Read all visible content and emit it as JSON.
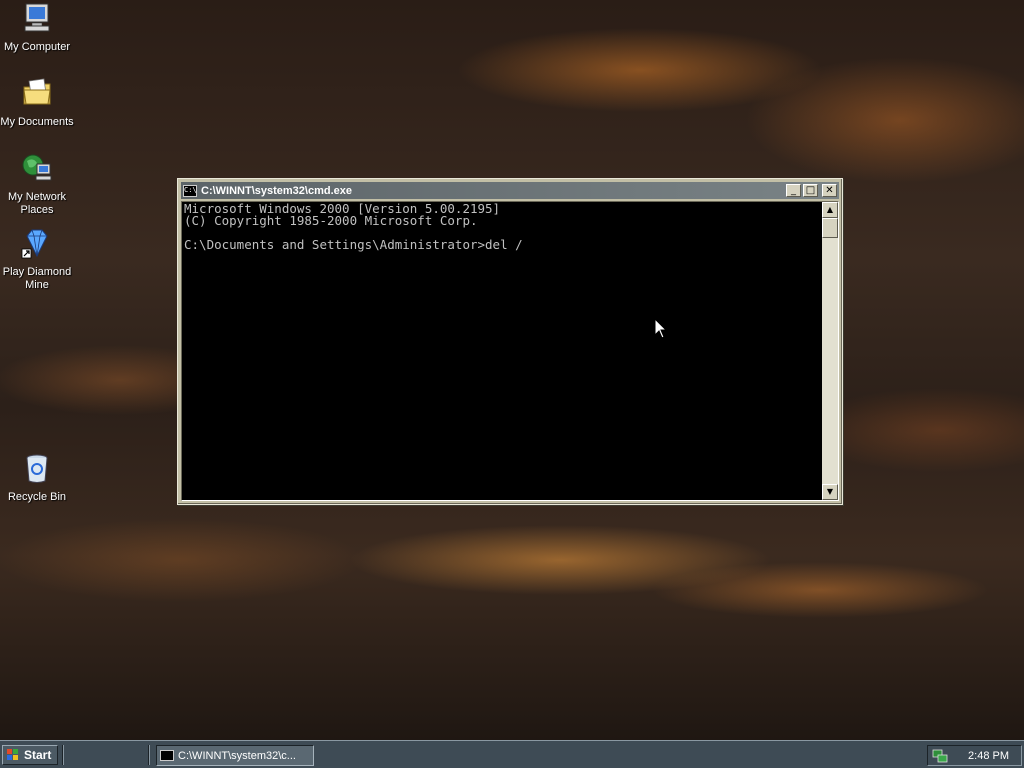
{
  "desktop": {
    "icons": [
      {
        "label": "My Computer",
        "icon": "my-computer-icon"
      },
      {
        "label": "My Documents",
        "icon": "my-documents-icon"
      },
      {
        "label_line1": "My Network",
        "label_line2": "Places",
        "icon": "network-places-icon"
      },
      {
        "label_line1": "Play Diamond",
        "label_line2": "Mine",
        "icon": "diamond-mine-icon"
      },
      {
        "label": "Recycle Bin",
        "icon": "recycle-bin-icon"
      }
    ]
  },
  "window": {
    "title": "C:\\WINNT\\system32\\cmd.exe",
    "buttons": {
      "minimize": "_",
      "maximize": "□",
      "close": "✕"
    },
    "console_lines": [
      "Microsoft Windows 2000 [Version 5.00.2195]",
      "(C) Copyright 1985-2000 Microsoft Corp.",
      "",
      "C:\\Documents and Settings\\Administrator>del /"
    ],
    "scroll": {
      "up": "▲",
      "down": "▼"
    }
  },
  "taskbar": {
    "start_label": "Start",
    "task_label": "C:\\WINNT\\system32\\c...",
    "clock": "2:48 PM"
  },
  "colors": {
    "console_bg": "#000000",
    "console_text": "#c0c0c0",
    "taskbar": "#3e4b55",
    "titlebar": "#5c6468"
  }
}
